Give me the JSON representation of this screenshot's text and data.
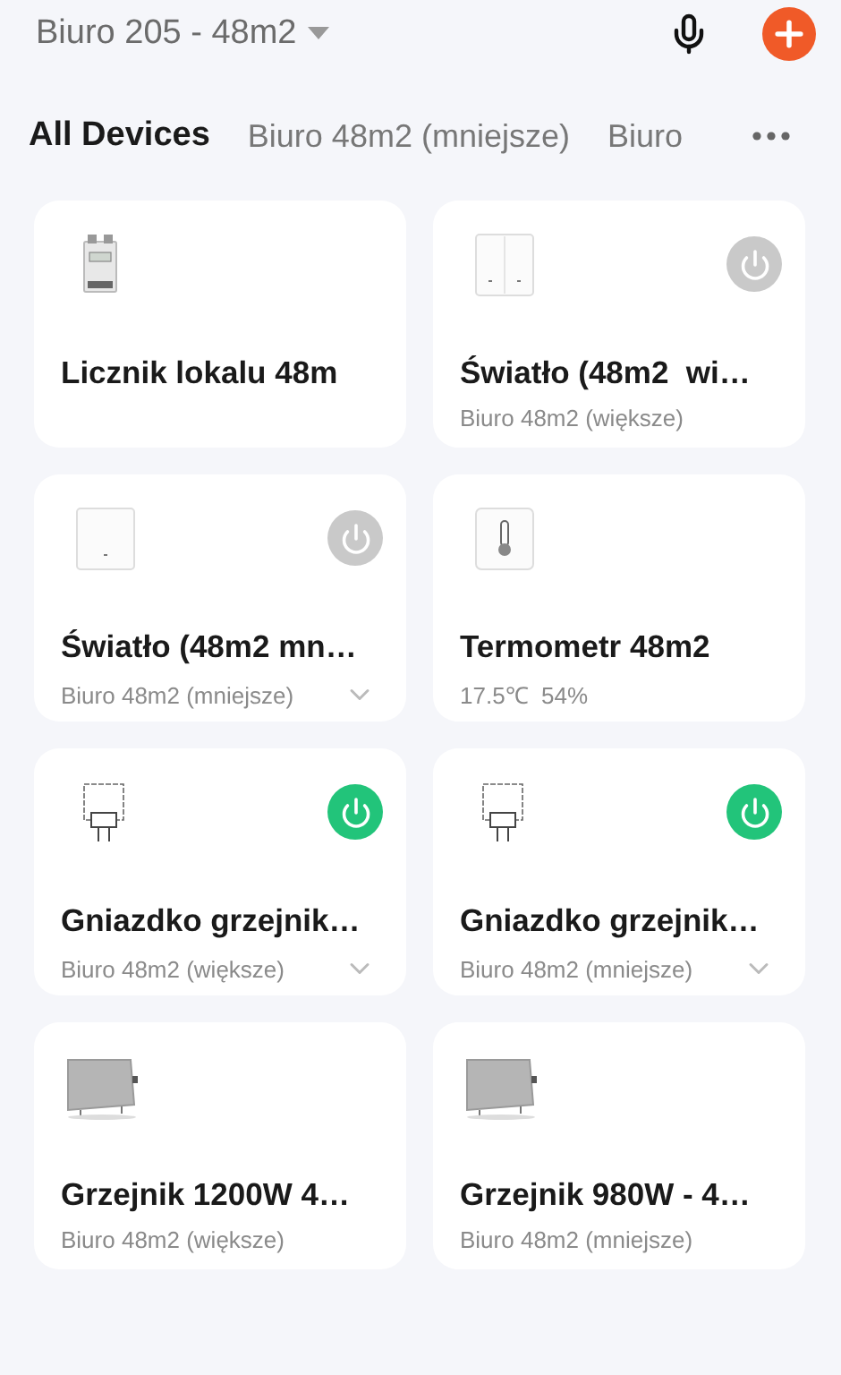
{
  "header": {
    "home_name": "Biuro 205 - 48m2"
  },
  "tabs": [
    {
      "label": "All Devices",
      "selected": true
    },
    {
      "label": "Biuro 48m2 (mniejsze)",
      "selected": false
    },
    {
      "label": "Biuro",
      "selected": false
    }
  ],
  "devices": [
    {
      "kind": "meter",
      "name": "Licznik lokalu 48m"
    },
    {
      "kind": "double_switch",
      "name": "Światło (48m2  wi…",
      "room": "Biuro 48m2 (większe)",
      "power_button": {
        "on": false
      },
      "expandable": false
    },
    {
      "kind": "single_switch",
      "name": "Światło (48m2 mn…",
      "room": "Biuro 48m2 (mniejsze)",
      "power_button": {
        "on": false
      },
      "expandable": true
    },
    {
      "kind": "thermometer",
      "name": "Termometr 48m2",
      "room": "17.5℃  54%"
    },
    {
      "kind": "plug",
      "name": "Gniazdko grzejnik…",
      "room": "Biuro 48m2 (większe)",
      "power_button": {
        "on": true
      },
      "expandable": true
    },
    {
      "kind": "plug",
      "name": "Gniazdko grzejnik…",
      "room": "Biuro 48m2 (mniejsze)",
      "power_button": {
        "on": true
      },
      "expandable": true
    },
    {
      "kind": "heater",
      "name": "Grzejnik 1200W 4…",
      "room": "Biuro 48m2 (większe)"
    },
    {
      "kind": "heater",
      "name": "Grzejnik 980W - 4…",
      "room": "Biuro 48m2 (mniejsze)"
    }
  ]
}
